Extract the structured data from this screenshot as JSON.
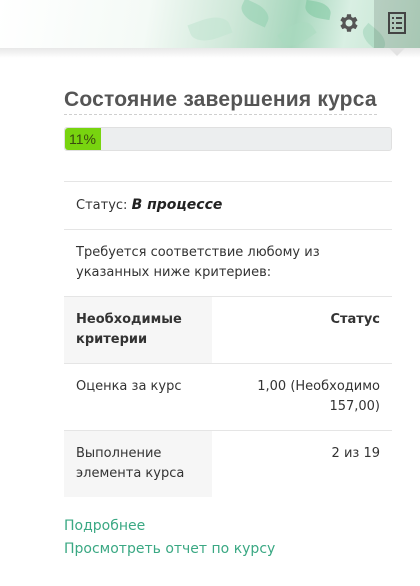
{
  "header": {
    "settings_icon": "gear-icon",
    "blocks_icon": "blocks-drawer-icon",
    "colors": {
      "leaf_green": "#9fd4b8"
    }
  },
  "block": {
    "title": "Состояние завершения курса",
    "progress": {
      "percent": 11,
      "label": "11%",
      "color": "#78d40f"
    },
    "status_label": "Статус:",
    "status_value": "В процессе",
    "requirement_note": "Требуется соответствие любому из указанных ниже критериев:",
    "table": {
      "headers": [
        "Необходимые критерии",
        "Статус"
      ],
      "rows": [
        {
          "criteria": "Оценка за курс",
          "status": "1,00 (Необходимо 157,00)"
        },
        {
          "criteria": "Выполнение элемента курса",
          "status": "2 из 19"
        }
      ]
    },
    "links": {
      "more_details": "Подробнее",
      "view_report": "Просмотреть отчет по курсу"
    },
    "colors": {
      "link": "#3aa883"
    }
  }
}
